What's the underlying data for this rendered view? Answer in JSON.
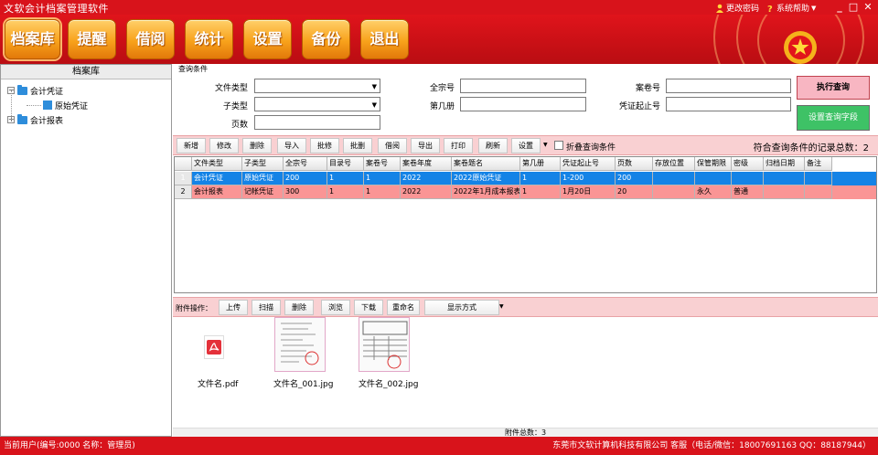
{
  "window": {
    "title": "文软会计档案管理软件",
    "change_pwd": "更改密码",
    "help": "系统帮助"
  },
  "toolbar": {
    "items": [
      "档案库",
      "提醒",
      "借阅",
      "统计",
      "设置",
      "备份",
      "退出"
    ]
  },
  "tree": {
    "title": "档案库",
    "nodes": [
      "会计凭证",
      "原始凭证",
      "会计报表"
    ]
  },
  "query": {
    "title": "查询条件",
    "labels": {
      "doc_type": "文件类型",
      "sub_type": "子类型",
      "pages": "页数",
      "full_no": "全宗号",
      "volume": "第几册",
      "case_no": "案卷号",
      "voucher_range": "凭证起止号"
    },
    "execute": "执行查询",
    "set_fields": "设置查询字段"
  },
  "actions": {
    "buttons": [
      "新增",
      "修改",
      "删除",
      "导入",
      "批修",
      "批删",
      "借阅",
      "导出",
      "打印",
      "刷新",
      "设置"
    ],
    "collapse": "折叠查询条件",
    "record_count": "符合查询条件的记录总数：2"
  },
  "table": {
    "headers": [
      "文件类型",
      "子类型",
      "全宗号",
      "目录号",
      "案卷号",
      "案卷年度",
      "案卷题名",
      "第几册",
      "凭证起止号",
      "页数",
      "存放位置",
      "保管期限",
      "密级",
      "归档日期",
      "备注"
    ],
    "rows": [
      {
        "no": "1",
        "cells": [
          "会计凭证",
          "原始凭证",
          "200",
          "1",
          "1",
          "2022",
          "2022原始凭证",
          "1",
          "1-200",
          "200",
          "",
          "",
          "",
          "",
          ""
        ]
      },
      {
        "no": "2",
        "cells": [
          "会计报表",
          "记帐凭证",
          "300",
          "1",
          "1",
          "2022",
          "2022年1月成本报表",
          "1",
          "1月20日",
          "20",
          "",
          "永久",
          "普通",
          "",
          ""
        ]
      }
    ]
  },
  "attachments": {
    "label": "附件操作：",
    "buttons": [
      "上传",
      "扫描",
      "删除",
      "浏览",
      "下载",
      "重命名"
    ],
    "display_mode": "显示方式",
    "files": [
      "文件名.pdf",
      "文件名_001.jpg",
      "文件名_002.jpg"
    ],
    "total": "附件总数：3"
  },
  "status": {
    "user": "当前用户(编号:0000  名称：管理员)",
    "company": "东莞市文软计算机科技有限公司  客服（电话/微信：18007691163  QQ：88187944）"
  }
}
